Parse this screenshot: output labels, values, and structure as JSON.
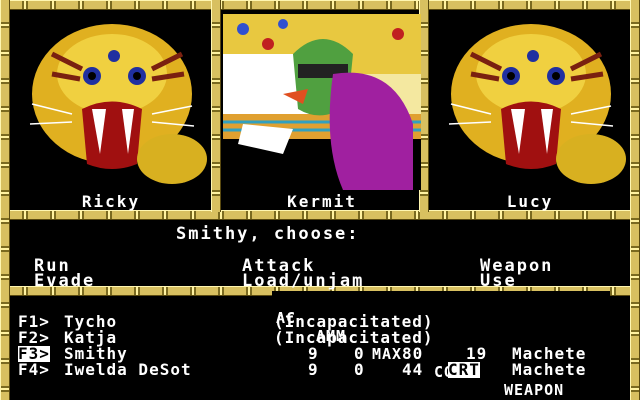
{
  "portraits": [
    {
      "name": "Ricky"
    },
    {
      "name": "Kermit"
    },
    {
      "name": "Lucy"
    }
  ],
  "prompt": "Smithy, choose:",
  "menu": {
    "run": "Run",
    "evade": "Evade",
    "attack": "Attack",
    "load_unjam": "Load/unjam",
    "weapon": "Weapon",
    "use": "Use"
  },
  "table": {
    "headers": [
      "AC",
      "AMM",
      "MAX",
      "CON",
      "WEAPON"
    ],
    "rows": [
      {
        "key": "F1>",
        "name": "Tycho",
        "status": "(Incapacitated)",
        "ac": "",
        "amm": "",
        "max": "",
        "con": "",
        "weapon": "",
        "selected": false
      },
      {
        "key": "F2>",
        "name": "Katja",
        "status": "(Incapacitated)",
        "ac": "",
        "amm": "",
        "max": "",
        "con": "",
        "weapon": "",
        "selected": false
      },
      {
        "key": "F3>",
        "name": "Smithy",
        "status": "",
        "ac": "9",
        "amm": "0",
        "max": "80",
        "con": "19",
        "weapon": "Machete",
        "selected": true
      },
      {
        "key": "F4>",
        "name": "Iwelda DeSot",
        "status": "",
        "ac": "9",
        "amm": "0",
        "max": "44",
        "con": "CRT",
        "weapon": "Machete",
        "selected": false
      }
    ]
  },
  "colors": {
    "frame": "#d8c060",
    "highlight": "#ffffff",
    "tiger_yellow": "#f0d020",
    "tiger_red": "#c01818"
  }
}
